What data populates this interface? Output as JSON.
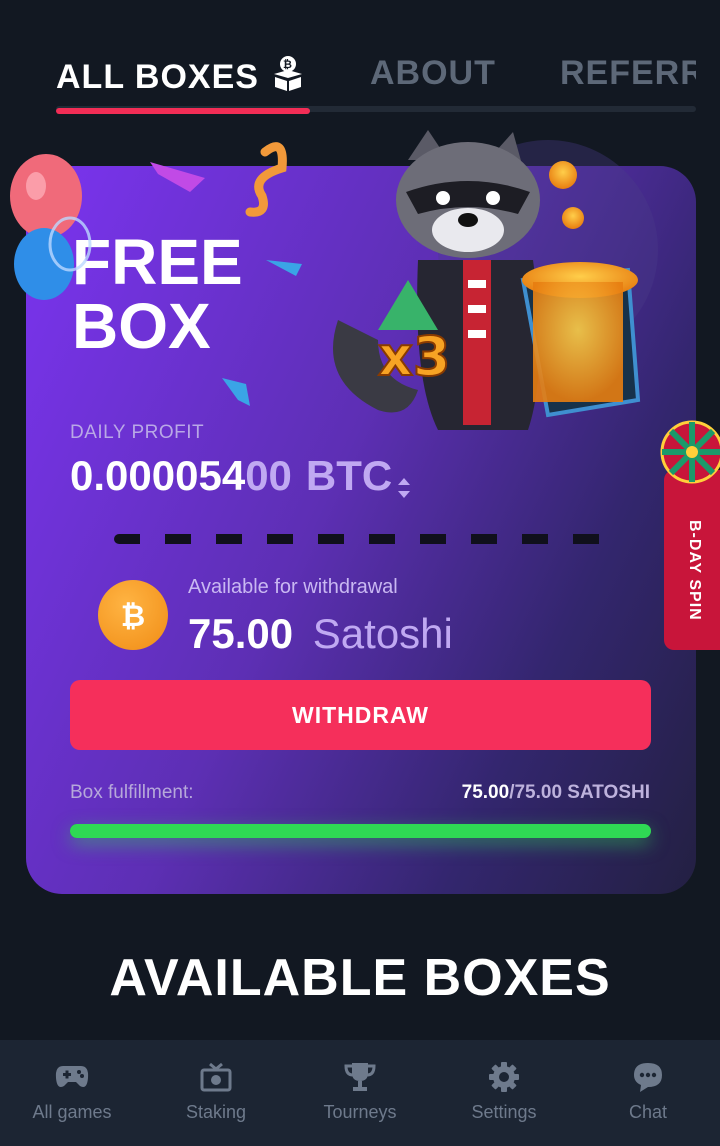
{
  "tabs": [
    {
      "label": "ALL BOXES",
      "active": true
    },
    {
      "label": "ABOUT",
      "active": false
    },
    {
      "label": "REFERRAL",
      "active": false
    }
  ],
  "card": {
    "title_line1": "FREE",
    "title_line2": "BOX",
    "daily_profit_label": "DAILY PROFIT",
    "daily_profit_bright": "0.000054",
    "daily_profit_dim": "00",
    "daily_profit_unit": "BTC",
    "multiplier": "x3",
    "available_label": "Available for withdrawal",
    "available_amount": "75.00",
    "available_unit": "Satoshi",
    "withdraw_button": "WITHDRAW",
    "fulfillment_label": "Box fulfillment:",
    "fulfillment_current": "75.00",
    "fulfillment_total": "/75.00 SATOSHI",
    "fulfillment_progress": 1.0
  },
  "bday_spin": "B-DAY SPIN",
  "section_title": "AVAILABLE BOXES",
  "nav": [
    {
      "label": "All games",
      "icon": "gamepad-icon"
    },
    {
      "label": "Staking",
      "icon": "staking-icon"
    },
    {
      "label": "Tourneys",
      "icon": "trophy-icon"
    },
    {
      "label": "Settings",
      "icon": "gear-icon"
    },
    {
      "label": "Chat",
      "icon": "chat-icon"
    }
  ],
  "colors": {
    "accent": "#f52f5b",
    "progress": "#2fd954",
    "card_from": "#7b34f0",
    "card_to": "#232042",
    "background": "#121822"
  }
}
